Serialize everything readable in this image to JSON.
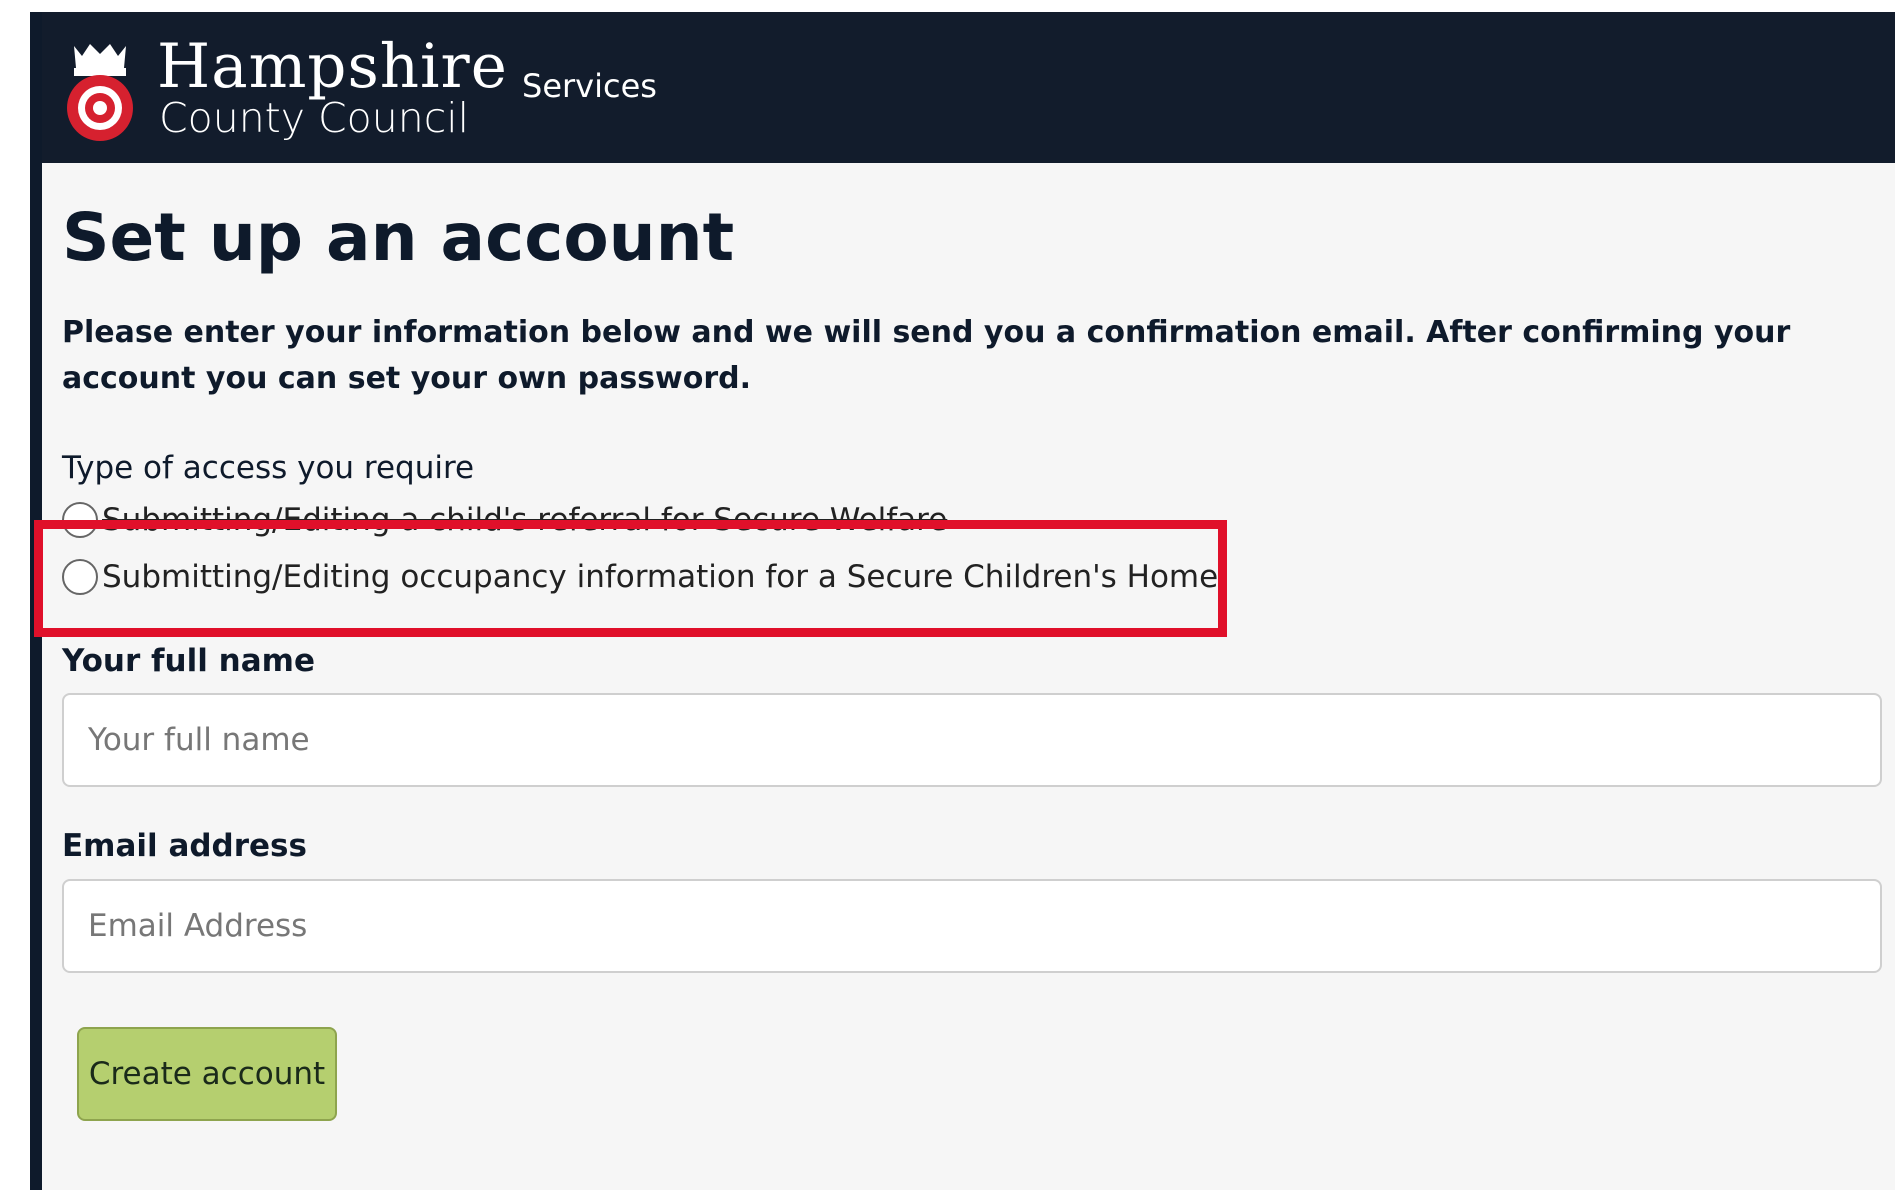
{
  "header": {
    "logo_line1": "Hampshire",
    "logo_line2": "County Council",
    "nav": {
      "services": "Services"
    }
  },
  "main": {
    "title": "Set up an account",
    "intro": "Please enter your information below and we will send you a confirmation email. After confirming your account you can set your own password.",
    "access": {
      "label": "Type of access you require",
      "options": [
        {
          "label": "Submitting/Editing a child's referral for Secure Welfare",
          "selected": false
        },
        {
          "label": "Submitting/Editing occupancy information for a Secure Children's Home",
          "selected": false
        }
      ]
    },
    "full_name": {
      "label": "Your full name",
      "placeholder": "Your full name",
      "value": ""
    },
    "email": {
      "label": "Email address",
      "placeholder": "Email Address",
      "value": ""
    },
    "submit_label": "Create account"
  },
  "colors": {
    "header_bg": "#121c2c",
    "page_bg": "#f6f6f6",
    "button_bg": "#b5cf6f",
    "highlight": "#e0102a"
  },
  "icons": {
    "crest": "hampshire-rose-crest-icon"
  }
}
